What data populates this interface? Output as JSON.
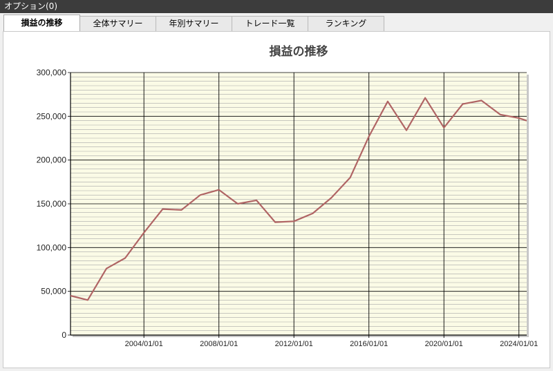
{
  "window": {
    "title": "オプション(0)"
  },
  "tabs": [
    {
      "label": "損益の推移",
      "active": true
    },
    {
      "label": "全体サマリー",
      "active": false
    },
    {
      "label": "年別サマリー",
      "active": false
    },
    {
      "label": "トレード一覧",
      "active": false
    },
    {
      "label": "ランキング",
      "active": false
    }
  ],
  "colors": {
    "plot_background": "#fbfbe6",
    "line": "#b06464",
    "major_grid": "#000000",
    "minor_grid": "#a8a8a8"
  },
  "chart_data": {
    "type": "line",
    "title": "損益の推移",
    "xlabel": "",
    "ylabel": "",
    "x_range": [
      "2000/02/01",
      "2024/06/01"
    ],
    "ylim": [
      0,
      300000
    ],
    "y_ticks": [
      "0",
      "50,000",
      "100,000",
      "150,000",
      "200,000",
      "250,000",
      "300,000"
    ],
    "x_ticks": [
      "2004/01/01",
      "2008/01/01",
      "2012/01/01",
      "2016/01/01",
      "2020/01/01",
      "2024/01/01"
    ],
    "grid": true,
    "legend": "none",
    "series": [
      {
        "points": [
          [
            "2000/02/01",
            45000
          ],
          [
            "2001/01/01",
            40000
          ],
          [
            "2002/01/01",
            76000
          ],
          [
            "2003/01/01",
            88000
          ],
          [
            "2004/01/01",
            117000
          ],
          [
            "2005/01/01",
            144000
          ],
          [
            "2006/01/01",
            143000
          ],
          [
            "2007/01/01",
            160000
          ],
          [
            "2008/01/01",
            166000
          ],
          [
            "2009/01/01",
            150000
          ],
          [
            "2010/01/01",
            154000
          ],
          [
            "2011/01/01",
            129000
          ],
          [
            "2012/01/01",
            130000
          ],
          [
            "2013/01/01",
            139000
          ],
          [
            "2014/01/01",
            157000
          ],
          [
            "2015/01/01",
            180000
          ],
          [
            "2016/01/01",
            227000
          ],
          [
            "2017/01/01",
            267000
          ],
          [
            "2018/01/01",
            234000
          ],
          [
            "2019/01/01",
            271000
          ],
          [
            "2020/01/01",
            237000
          ],
          [
            "2021/01/01",
            264000
          ],
          [
            "2022/01/01",
            268000
          ],
          [
            "2023/01/01",
            252000
          ],
          [
            "2024/01/01",
            248000
          ],
          [
            "2024/06/01",
            245000
          ]
        ]
      }
    ]
  }
}
